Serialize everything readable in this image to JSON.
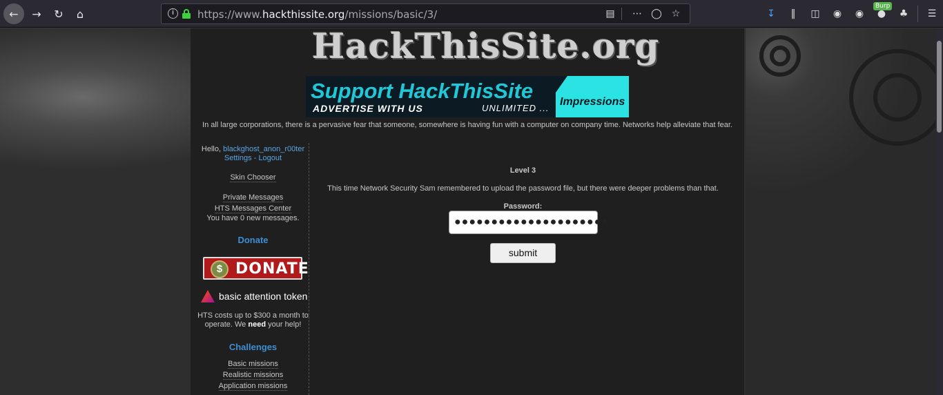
{
  "browser": {
    "url_prefix": "https://www.",
    "url_host": "hackthissite.org",
    "url_path": "/missions/basic/3/",
    "burp_badge": "Burp"
  },
  "site": {
    "logo_text": "HackThisSite.org",
    "banner": {
      "line1": "Support HackThisSite",
      "line2": "ADVERTISE WITH US",
      "line3": "UNLIMITED ...",
      "tag": "Impressions"
    },
    "quote": "In all large corporations, there is a pervasive fear that someone, somewhere is having fun with a computer on company time. Networks help alleviate that fear."
  },
  "sidebar": {
    "hello": "Hello,",
    "username": "blackghost_anon_r00ter",
    "settings": "Settings",
    "logout": "Logout",
    "skin_chooser": "Skin Chooser",
    "private_messages": "Private Messages",
    "messages_center": "HTS Messages Center",
    "new_messages": "You have 0 new messages.",
    "donate_heading": "Donate",
    "donate_button": "DONATE",
    "bat": "basic attention token",
    "costs_1": "HTS costs up to $300 a month to",
    "costs_2": "operate. We",
    "costs_need": "need",
    "costs_3": "your help!",
    "challenges_heading": "Challenges",
    "challenges": [
      "Basic missions",
      "Realistic missions",
      "Application missions"
    ]
  },
  "main": {
    "level": "Level 3",
    "description": "This time Network Security Sam remembered to upload the password file, but there were deeper problems than that.",
    "password_label": "Password:",
    "password_value": "●●●●●●●●●●●●●●●●●●●●●",
    "submit": "submit"
  }
}
